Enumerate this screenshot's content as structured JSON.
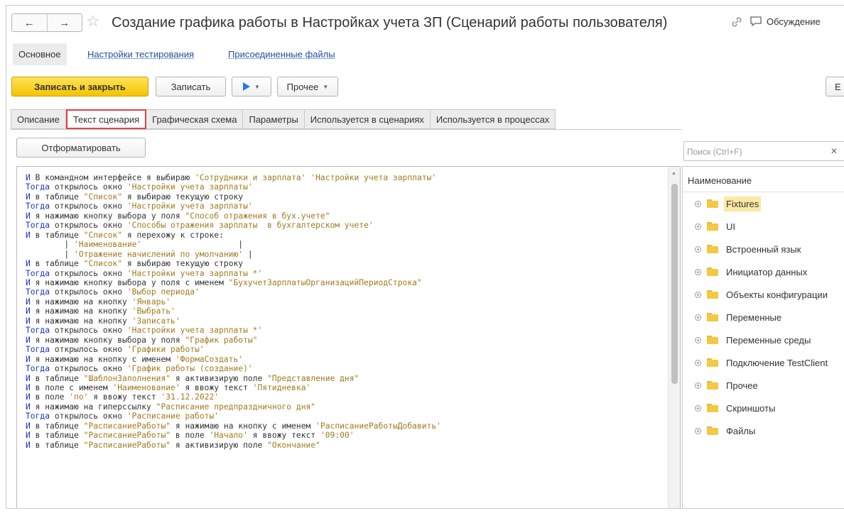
{
  "window": {
    "title": "Создание графика работы в Настройках учета ЗП (Сценарий работы пользователя)",
    "discuss_label": "Обсуждение"
  },
  "nav_tabs": {
    "main": "Основное",
    "testing_settings": "Настройки тестирования",
    "attached_files": "Присоединенные файлы"
  },
  "toolbar": {
    "save_close": "Записать и закрыть",
    "save": "Записать",
    "more": "Прочее",
    "right_cut": "Е"
  },
  "content_tabs": [
    {
      "label": "Описание"
    },
    {
      "label": "Текст сценария"
    },
    {
      "label": "Графическая схема"
    },
    {
      "label": "Параметры"
    },
    {
      "label": "Используется в сценариях"
    },
    {
      "label": "Используется в процессах"
    }
  ],
  "format_button": "Отформатировать",
  "search": {
    "placeholder": "Поиск (Ctrl+F)"
  },
  "tree": {
    "header": "Наименование",
    "items": [
      {
        "label": "Fixtures"
      },
      {
        "label": "UI"
      },
      {
        "label": "Встроенный язык"
      },
      {
        "label": "Инициатор данных"
      },
      {
        "label": "Объекты конфигурации"
      },
      {
        "label": "Переменные"
      },
      {
        "label": "Переменные среды"
      },
      {
        "label": "Подключение TestClient"
      },
      {
        "label": "Прочее"
      },
      {
        "label": "Скриншоты"
      },
      {
        "label": "Файлы"
      }
    ]
  },
  "colors": {
    "keyword": "#1b34c9",
    "string": "#a07b1f",
    "primary_button": "#f5c400",
    "active_tab_border": "#e0414a",
    "link": "#1f4ea3"
  },
  "script_lines": [
    [
      [
        "kw",
        "И"
      ],
      [
        "t",
        " В командном интерфейсе я выбираю "
      ],
      [
        "str",
        "'Сотрудники и зарплата'"
      ],
      [
        "t",
        " "
      ],
      [
        "str",
        "'Настройки учета зарплаты'"
      ]
    ],
    [
      [
        "kw",
        "Тогда"
      ],
      [
        "t",
        " открылось окно "
      ],
      [
        "str",
        "'Настройки учета зарплаты'"
      ]
    ],
    [
      [
        "kw",
        "И"
      ],
      [
        "t",
        " в таблице "
      ],
      [
        "str",
        "\"Список\""
      ],
      [
        "t",
        " я выбираю текущую строку"
      ]
    ],
    [
      [
        "kw",
        "Тогда"
      ],
      [
        "t",
        " открылось окно "
      ],
      [
        "str",
        "'Настройки учета зарплаты'"
      ]
    ],
    [
      [
        "kw",
        "И"
      ],
      [
        "t",
        " я нажимаю кнопку выбора у поля "
      ],
      [
        "str",
        "\"Способ отражения в бух.учете\""
      ]
    ],
    [
      [
        "kw",
        "Тогда"
      ],
      [
        "t",
        " открылось окно "
      ],
      [
        "str",
        "'Способы отражения зарплаты  в бухгалтерском учете'"
      ]
    ],
    [
      [
        "kw",
        "И"
      ],
      [
        "t",
        " в таблице "
      ],
      [
        "str",
        "\"Список\""
      ],
      [
        "t",
        " я перехожу к строке:"
      ]
    ],
    [
      [
        "t",
        "        | "
      ],
      [
        "str",
        "'Наименование'"
      ],
      [
        "t",
        "                    |"
      ]
    ],
    [
      [
        "t",
        "        | "
      ],
      [
        "str",
        "'Отражение начислений по умолчанию'"
      ],
      [
        "t",
        " |"
      ]
    ],
    [
      [
        "kw",
        "И"
      ],
      [
        "t",
        " в таблице "
      ],
      [
        "str",
        "\"Список\""
      ],
      [
        "t",
        " я выбираю текущую строку"
      ]
    ],
    [
      [
        "kw",
        "Тогда"
      ],
      [
        "t",
        " открылось окно "
      ],
      [
        "str",
        "'Настройки учета зарплаты *'"
      ]
    ],
    [
      [
        "kw",
        "И"
      ],
      [
        "t",
        " я нажимаю кнопку выбора у поля с именем "
      ],
      [
        "str",
        "\"БухучетЗарплатыОрганизацийПериодСтрока\""
      ]
    ],
    [
      [
        "kw",
        "Тогда"
      ],
      [
        "t",
        " открылось окно "
      ],
      [
        "str",
        "'Выбор периода'"
      ]
    ],
    [
      [
        "kw",
        "И"
      ],
      [
        "t",
        " я нажимаю на кнопку "
      ],
      [
        "str",
        "'Январь'"
      ]
    ],
    [
      [
        "kw",
        "И"
      ],
      [
        "t",
        " я нажимаю на кнопку "
      ],
      [
        "str",
        "'Выбрать'"
      ]
    ],
    [
      [
        "kw",
        "И"
      ],
      [
        "t",
        " я нажимаю на кнопку "
      ],
      [
        "str",
        "'Записать'"
      ]
    ],
    [
      [
        "kw",
        "Тогда"
      ],
      [
        "t",
        " открылось окно "
      ],
      [
        "str",
        "'Настройки учета зарплаты *'"
      ]
    ],
    [
      [
        "kw",
        "И"
      ],
      [
        "t",
        " я нажимаю кнопку выбора у поля "
      ],
      [
        "str",
        "\"График работы\""
      ]
    ],
    [
      [
        "kw",
        "Тогда"
      ],
      [
        "t",
        " открылось окно "
      ],
      [
        "str",
        "'Графики работы'"
      ]
    ],
    [
      [
        "kw",
        "И"
      ],
      [
        "t",
        " я нажимаю на кнопку с именем "
      ],
      [
        "str",
        "'ФормаСоздать'"
      ]
    ],
    [
      [
        "kw",
        "Тогда"
      ],
      [
        "t",
        " открылось окно "
      ],
      [
        "str",
        "'График работы (создание)'"
      ]
    ],
    [
      [
        "kw",
        "И"
      ],
      [
        "t",
        " в таблице "
      ],
      [
        "str",
        "\"ШаблонЗаполнения\""
      ],
      [
        "t",
        " я активизирую поле "
      ],
      [
        "str",
        "\"Представление дня\""
      ]
    ],
    [
      [
        "kw",
        "И"
      ],
      [
        "t",
        " в поле с именем "
      ],
      [
        "str",
        "'Наименование'"
      ],
      [
        "t",
        " я ввожу текст "
      ],
      [
        "str",
        "'Пятидневка'"
      ]
    ],
    [
      [
        "kw",
        "И"
      ],
      [
        "t",
        " в поле "
      ],
      [
        "str",
        "'по'"
      ],
      [
        "t",
        " я ввожу текст "
      ],
      [
        "str",
        "'31.12.2022'"
      ]
    ],
    [
      [
        "kw",
        "И"
      ],
      [
        "t",
        " я нажимаю на гиперссылку "
      ],
      [
        "str",
        "\"Расписание предпраздничного дня\""
      ]
    ],
    [
      [
        "kw",
        "Тогда"
      ],
      [
        "t",
        " открылось окно "
      ],
      [
        "str",
        "'Расписание работы'"
      ]
    ],
    [
      [
        "kw",
        "И"
      ],
      [
        "t",
        " в таблице "
      ],
      [
        "str",
        "\"РасписаниеРаботы\""
      ],
      [
        "t",
        " я нажимаю на кнопку с именем "
      ],
      [
        "str",
        "'РасписаниеРаботыДобавить'"
      ]
    ],
    [
      [
        "kw",
        "И"
      ],
      [
        "t",
        " в таблице "
      ],
      [
        "str",
        "\"РасписаниеРаботы\""
      ],
      [
        "t",
        " в поле "
      ],
      [
        "str",
        "'Начало'"
      ],
      [
        "t",
        " я ввожу текст "
      ],
      [
        "str",
        "'09:00'"
      ]
    ],
    [
      [
        "kw",
        "И"
      ],
      [
        "t",
        " в таблице "
      ],
      [
        "str",
        "\"РасписаниеРаботы\""
      ],
      [
        "t",
        " я активизирую поле "
      ],
      [
        "str",
        "\"Окончание\""
      ]
    ]
  ]
}
